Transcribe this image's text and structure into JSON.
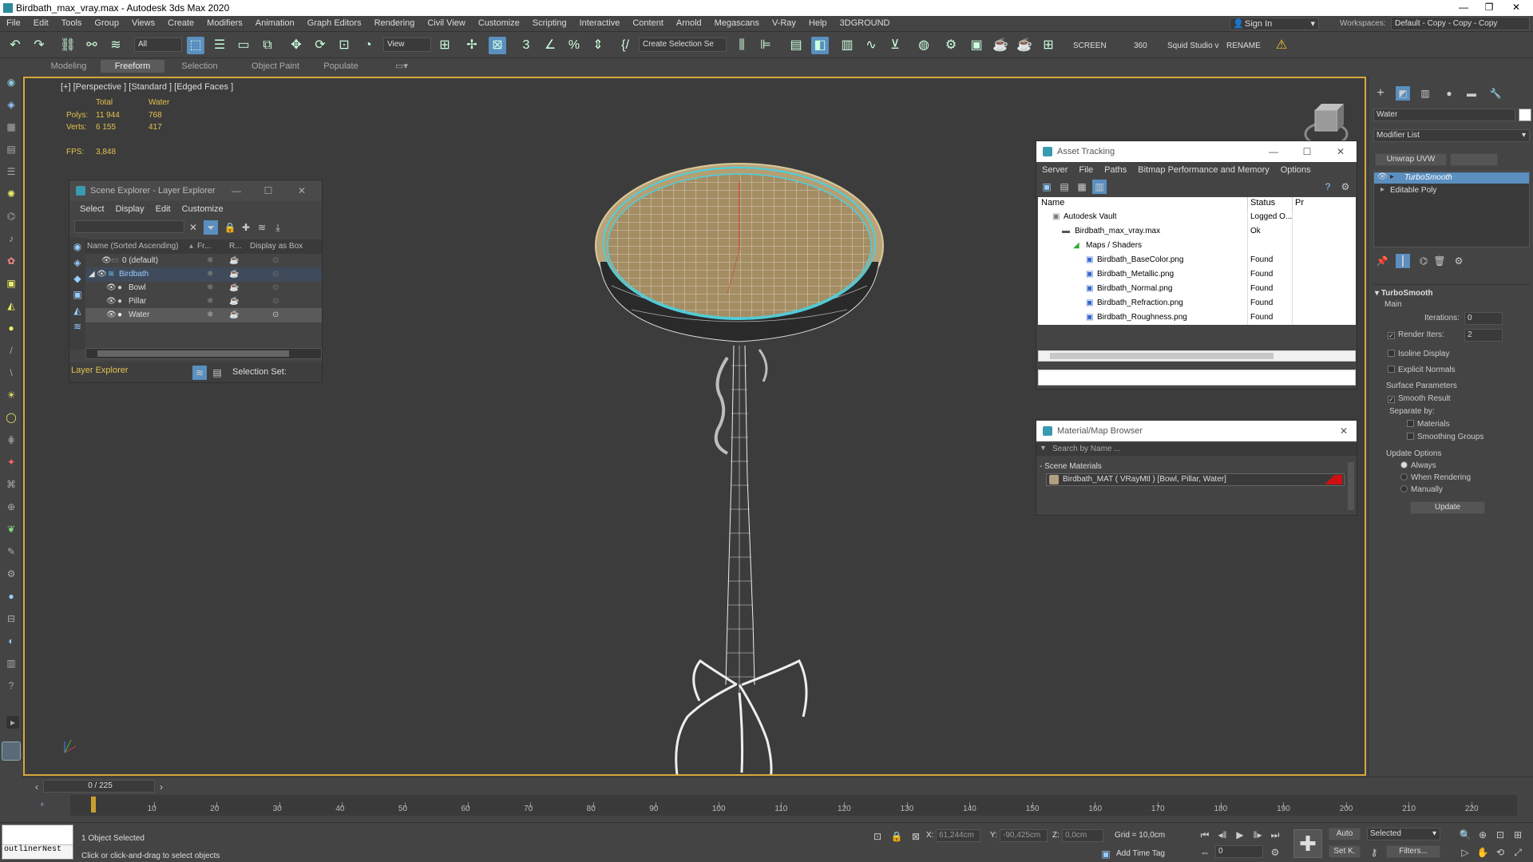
{
  "title": "Birdbath_max_vray.max - Autodesk 3ds Max 2020",
  "menu": [
    "File",
    "Edit",
    "Tools",
    "Group",
    "Views",
    "Create",
    "Modifiers",
    "Animation",
    "Graph Editors",
    "Rendering",
    "Civil View",
    "Customize",
    "Scripting",
    "Interactive",
    "Content",
    "Arnold",
    "Megascans",
    "V-Ray",
    "Help",
    "3DGROUND"
  ],
  "signin": "Sign In",
  "workspaces_label": "Workspaces:",
  "workspace_value": "Default - Copy - Copy - Copy",
  "toolbar": {
    "filter": "All",
    "view": "View",
    "selection_set": "Create Selection Se",
    "screen": "SCREEN",
    "deg360": "360",
    "squid": "Squid Studio v",
    "rename": "RENAME"
  },
  "ribbon_tabs": [
    "Modeling",
    "Freeform",
    "Selection",
    "Object Paint",
    "Populate"
  ],
  "viewport": {
    "label": "[+] [Perspective ] [Standard ] [Edged Faces ]",
    "stats_header_total": "Total",
    "stats_header_water": "Water",
    "polys_label": "Polys:",
    "polys_total": "11 944",
    "polys_water": "768",
    "verts_label": "Verts:",
    "verts_total": "6 155",
    "verts_water": "417",
    "fps_label": "FPS:",
    "fps_value": "3,848"
  },
  "scene_explorer": {
    "title": "Scene Explorer - Layer Explorer",
    "menu": [
      "Select",
      "Display",
      "Edit",
      "Customize"
    ],
    "col_name": "Name (Sorted Ascending)",
    "col_fr": "Fr...",
    "col_r": "R...",
    "col_box": "Display as Box",
    "rows": [
      {
        "name": "0 (default)",
        "indent": 0
      },
      {
        "name": "Birdbath",
        "indent": 0
      },
      {
        "name": "Bowl",
        "indent": 1
      },
      {
        "name": "Pillar",
        "indent": 1
      },
      {
        "name": "Water",
        "indent": 1
      }
    ],
    "footer_layer": "Layer Explorer",
    "footer_selset": "Selection Set:"
  },
  "asset_tracking": {
    "title": "Asset Tracking",
    "menu": [
      "Server",
      "File",
      "Paths",
      "Bitmap Performance and Memory",
      "Options"
    ],
    "col_name": "Name",
    "col_status": "Status",
    "col_pr": "Pr",
    "rows": [
      {
        "name": "Autodesk Vault",
        "status": "Logged O..."
      },
      {
        "name": "Birdbath_max_vray.max",
        "status": "Ok"
      },
      {
        "name": "Maps / Shaders",
        "status": ""
      },
      {
        "name": "Birdbath_BaseColor.png",
        "status": "Found"
      },
      {
        "name": "Birdbath_Metallic.png",
        "status": "Found"
      },
      {
        "name": "Birdbath_Normal.png",
        "status": "Found"
      },
      {
        "name": "Birdbath_Refraction.png",
        "status": "Found"
      },
      {
        "name": "Birdbath_Roughness.png",
        "status": "Found"
      }
    ]
  },
  "material_browser": {
    "title": "Material/Map Browser",
    "search_placeholder": "Search by Name ...",
    "section": "- Scene Materials",
    "material": "Birdbath_MAT ( VRayMtl ) [Bowl, Pillar, Water]"
  },
  "command_panel": {
    "object_name": "Water",
    "modifier_list": "Modifier List",
    "unwrap_btn": "Unwrap UVW",
    "stack": [
      "TurboSmooth",
      "Editable Poly"
    ],
    "rollout_title": "TurboSmooth",
    "main_label": "Main",
    "iterations_label": "Iterations:",
    "iterations_value": "0",
    "render_iters_label": "Render Iters:",
    "render_iters_value": "2",
    "isoline": "Isoline Display",
    "explicit": "Explicit Normals",
    "surface_params": "Surface Parameters",
    "smooth_result": "Smooth Result",
    "separate_by": "Separate by:",
    "materials": "Materials",
    "smoothing_groups": "Smoothing Groups",
    "update_options": "Update Options",
    "always": "Always",
    "when_rendering": "When Rendering",
    "manually": "Manually",
    "update_btn": "Update"
  },
  "timeline": {
    "frame": "0 / 225",
    "ticks": [
      "10",
      "20",
      "30",
      "40",
      "50",
      "60",
      "70",
      "80",
      "90",
      "100",
      "110",
      "120",
      "130",
      "140",
      "150",
      "160",
      "170",
      "180",
      "190",
      "200",
      "210",
      "220"
    ]
  },
  "status": {
    "script_box": "outlinerNest",
    "selected": "1 Object Selected",
    "prompt": "Click or click-and-drag to select objects",
    "x_label": "X:",
    "x_val": "61,244cm",
    "y_label": "Y:",
    "y_val": "-90,425cm",
    "z_label": "Z:",
    "z_val": "0,0cm",
    "grid": "Grid = 10,0cm",
    "add_time_tag": "Add Time Tag",
    "auto": "Auto",
    "setk": "Set K.",
    "selected_dd": "Selected",
    "filters": "Filters...",
    "frame_field": "0"
  }
}
